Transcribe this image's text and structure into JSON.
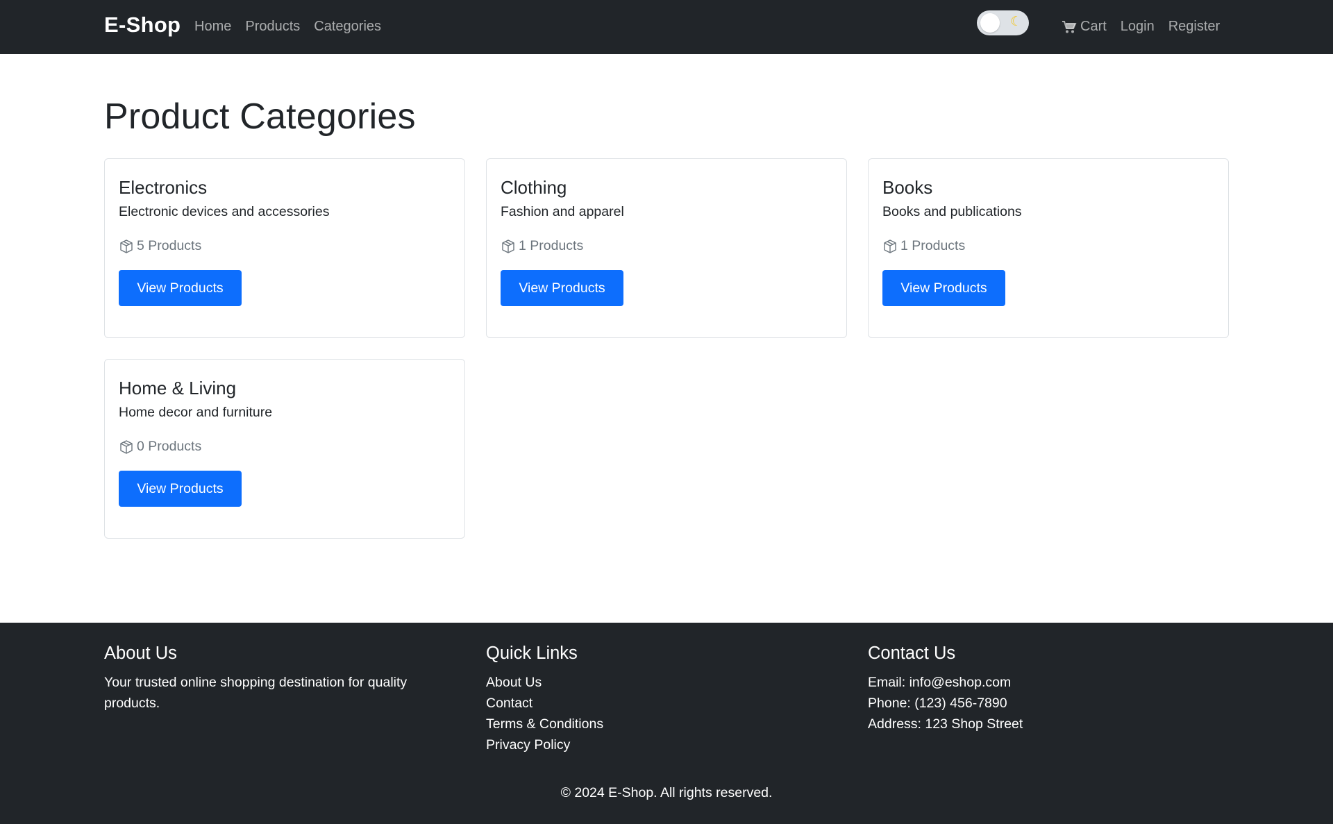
{
  "navbar": {
    "brand": "E-Shop",
    "links": [
      "Home",
      "Products",
      "Categories"
    ],
    "cart": "Cart",
    "login": "Login",
    "register": "Register",
    "toggle_icon": "moon-icon"
  },
  "main": {
    "title": "Product Categories",
    "categories": [
      {
        "name": "Electronics",
        "description": "Electronic devices and accessories",
        "count": "5 Products",
        "button": "View Products"
      },
      {
        "name": "Clothing",
        "description": "Fashion and apparel",
        "count": "1 Products",
        "button": "View Products"
      },
      {
        "name": "Books",
        "description": "Books and publications",
        "count": "1 Products",
        "button": "View Products"
      },
      {
        "name": "Home & Living",
        "description": "Home decor and furniture",
        "count": "0 Products",
        "button": "View Products"
      }
    ]
  },
  "footer": {
    "about": {
      "title": "About Us",
      "text": "Your trusted online shopping destination for quality products."
    },
    "quick_links": {
      "title": "Quick Links",
      "items": [
        "About Us",
        "Contact",
        "Terms & Conditions",
        "Privacy Policy"
      ]
    },
    "contact": {
      "title": "Contact Us",
      "email": "Email: info@eshop.com",
      "phone": "Phone: (123) 456-7890",
      "address": "Address: 123 Shop Street"
    },
    "copyright": "© 2024 E-Shop. All rights reserved."
  },
  "colors": {
    "navbar": "#212529",
    "primary": "#0d6efd",
    "muted": "#6c757d",
    "toggle_moon": "#f5c518"
  }
}
